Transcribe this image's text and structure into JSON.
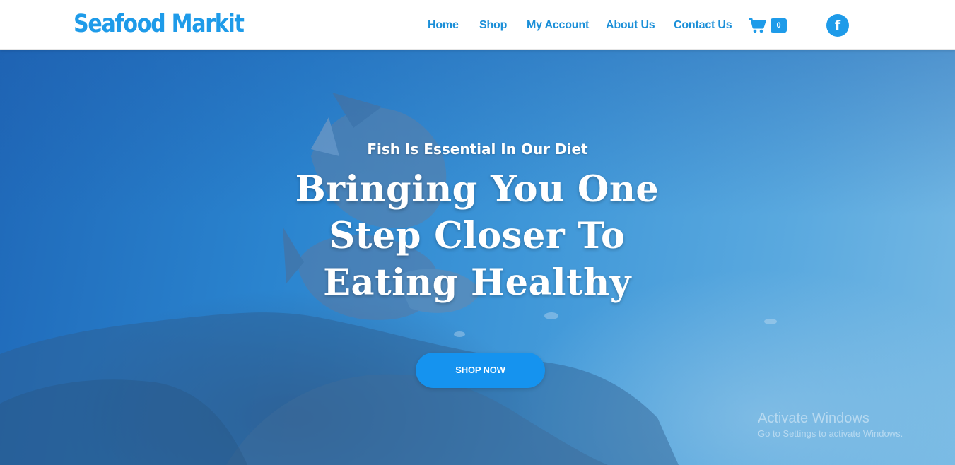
{
  "brand": {
    "logo_text": "Seafood Markit",
    "accent": "#1e9be9"
  },
  "nav": {
    "items": [
      {
        "label": "Home"
      },
      {
        "label": "Shop"
      },
      {
        "label": "My Account"
      },
      {
        "label": "About Us"
      },
      {
        "label": "Contact Us"
      }
    ]
  },
  "cart": {
    "icon": "cart-icon",
    "count": "0"
  },
  "social": {
    "facebook_icon": "facebook-icon",
    "glyph": "f"
  },
  "hero": {
    "tagline": "Fish Is Essential In Our Diet",
    "headline_lines": [
      "Bringing You One",
      "Step Closer To",
      "Eating Healthy"
    ],
    "cta_label": "SHOP NOW",
    "cta_color": "#1593ef"
  },
  "watermark": {
    "line1": "Activate Windows",
    "line2": "Go to Settings to activate Windows."
  }
}
